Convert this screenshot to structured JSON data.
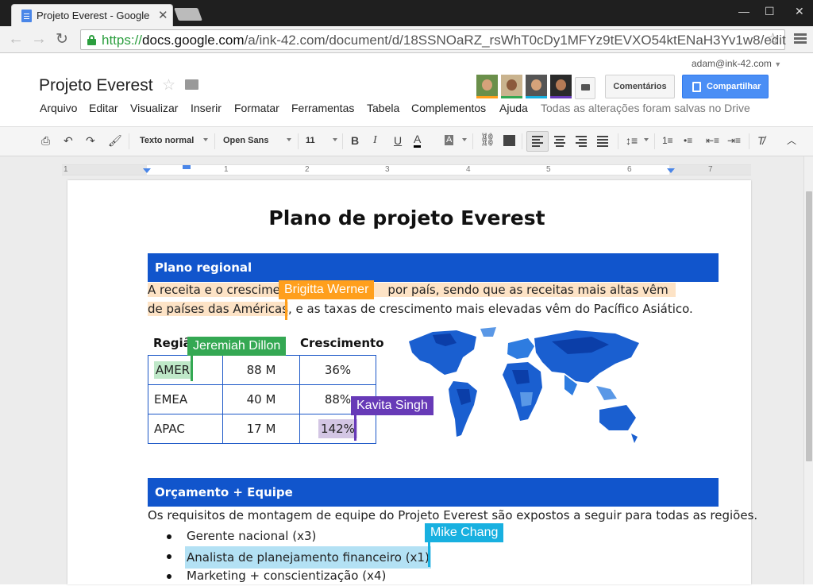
{
  "browser": {
    "tab_title": "Projeto Everest - Google",
    "url_scheme": "https://",
    "url_host": "docs.google.com",
    "url_path": "/a/ink-42.com/document/d/18SSNOaRZ_rsWhT0cDy1MFYz9tEVXO54ktENaH3Yv1w8/edit"
  },
  "docs": {
    "account": "adam@ink-42.com",
    "title": "Projeto Everest",
    "comments_label": "Comentários",
    "share_label": "Compartilhar",
    "menu": [
      "Arquivo",
      "Editar",
      "Visualizar",
      "Inserir",
      "Formatar",
      "Ferramentas",
      "Tabela",
      "Complementos",
      "Ajuda"
    ],
    "save_status": "Todas as alterações foram salvas no Drive",
    "collaborator_colors": [
      "#ff9f1c",
      "#34a853",
      "#18b0e0",
      "#673ab7"
    ]
  },
  "format_toolbar": {
    "style": "Texto normal",
    "font": "Open Sans",
    "size": "11"
  },
  "ruler": {
    "labels": [
      "1",
      "1",
      "2",
      "3",
      "4",
      "5",
      "6",
      "7"
    ]
  },
  "document": {
    "heading": "Plano de projeto Everest",
    "section1": "Plano regional",
    "para1_line1_a": "A receita e o crescimen",
    "para1_line1_b": "por país, sendo que as receitas mais altas vêm",
    "para1_line2_a": "de países das Américas",
    "para1_line2_b": ", e as taxas de crescimento mais elevadas vêm do Pacífico Asiático.",
    "table": {
      "headers": [
        "Regiã",
        "Crescimento"
      ],
      "rows": [
        [
          "AMER",
          "88 M",
          "36%"
        ],
        [
          "EMEA",
          "40 M",
          "88%"
        ],
        [
          "APAC",
          "17 M",
          "142%"
        ]
      ]
    },
    "section2": "Orçamento + Equipe",
    "para2": "Os requisitos de montagem de equipe do Projeto Everest são expostos a seguir para todas as regiões.",
    "bullets": [
      "Gerente nacional (x3)",
      "Analista de planejamento financeiro (x1)",
      "Marketing + conscientização (x4)"
    ]
  },
  "collaborators": [
    {
      "name": "Brigitta Werner",
      "color": "#ff9f1c"
    },
    {
      "name": "Jeremiah Dillon",
      "color": "#34a853"
    },
    {
      "name": "Kavita Singh",
      "color": "#673ab7"
    },
    {
      "name": "Mike Chang",
      "color": "#18b0e0"
    }
  ]
}
